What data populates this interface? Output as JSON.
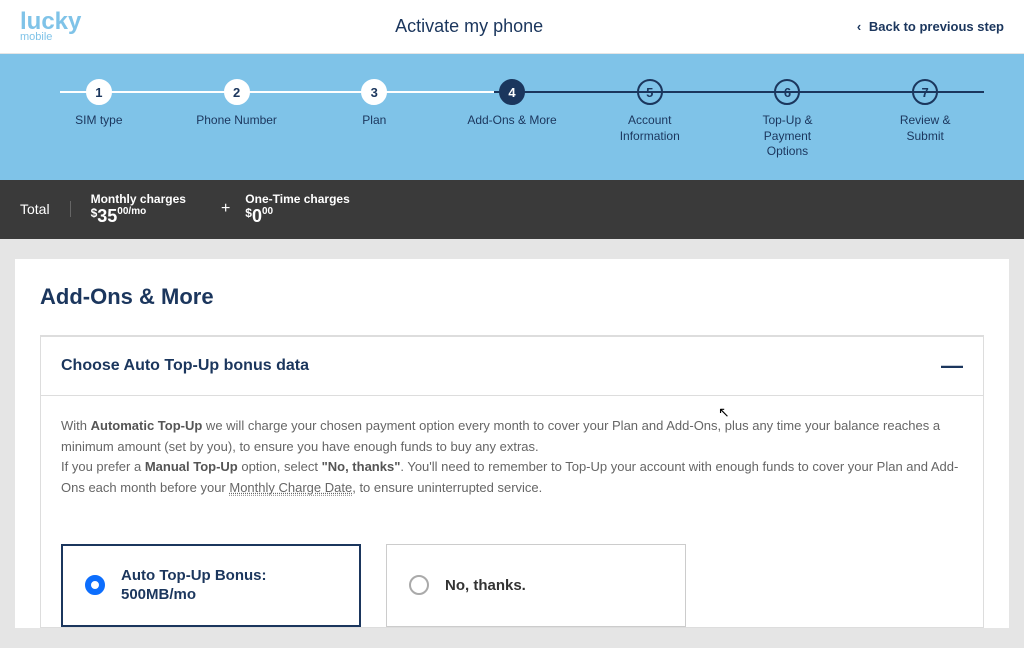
{
  "header": {
    "logo_main": "lucky",
    "logo_sub": "mobile",
    "title": "Activate my phone",
    "back_label": "Back to previous step"
  },
  "steps": [
    {
      "num": "1",
      "label": "SIM type",
      "state": "done"
    },
    {
      "num": "2",
      "label": "Phone Number",
      "state": "done"
    },
    {
      "num": "3",
      "label": "Plan",
      "state": "done"
    },
    {
      "num": "4",
      "label": "Add-Ons & More",
      "state": "current"
    },
    {
      "num": "5",
      "label": "Account Information",
      "state": "pending"
    },
    {
      "num": "6",
      "label": "Top-Up & Payment Options",
      "state": "pending"
    },
    {
      "num": "7",
      "label": "Review & Submit",
      "state": "pending"
    }
  ],
  "totals": {
    "label": "Total",
    "monthly_label": "Monthly charges",
    "monthly_amount": "35",
    "monthly_cents": "00",
    "monthly_suffix": "/mo",
    "plus": "+",
    "onetime_label": "One-Time charges",
    "onetime_amount": "0",
    "onetime_cents": "00"
  },
  "section_title": "Add-Ons & More",
  "panel": {
    "title": "Choose Auto Top-Up bonus data",
    "collapse_symbol": "—",
    "p1_pre": "With ",
    "p1_b": "Automatic Top-Up",
    "p1_post": " we will charge your chosen payment option every month to cover your Plan and Add-Ons, plus any time your balance reaches a minimum amount (set by you), to ensure you have enough funds to buy any extras.",
    "p2_pre": "If you prefer a ",
    "p2_b1": "Manual Top-Up",
    "p2_mid": " option, select ",
    "p2_b2": "\"No, thanks\"",
    "p2_post": ". You'll need to remember to Top-Up your account with enough funds to cover your Plan and Add-Ons each month before your ",
    "p2_link": "Monthly Charge Date",
    "p2_tail": ", to ensure uninterrupted service."
  },
  "options": {
    "opt1_line1": "Auto Top-Up Bonus:",
    "opt1_line2": "500MB/mo",
    "opt2": "No, thanks."
  }
}
